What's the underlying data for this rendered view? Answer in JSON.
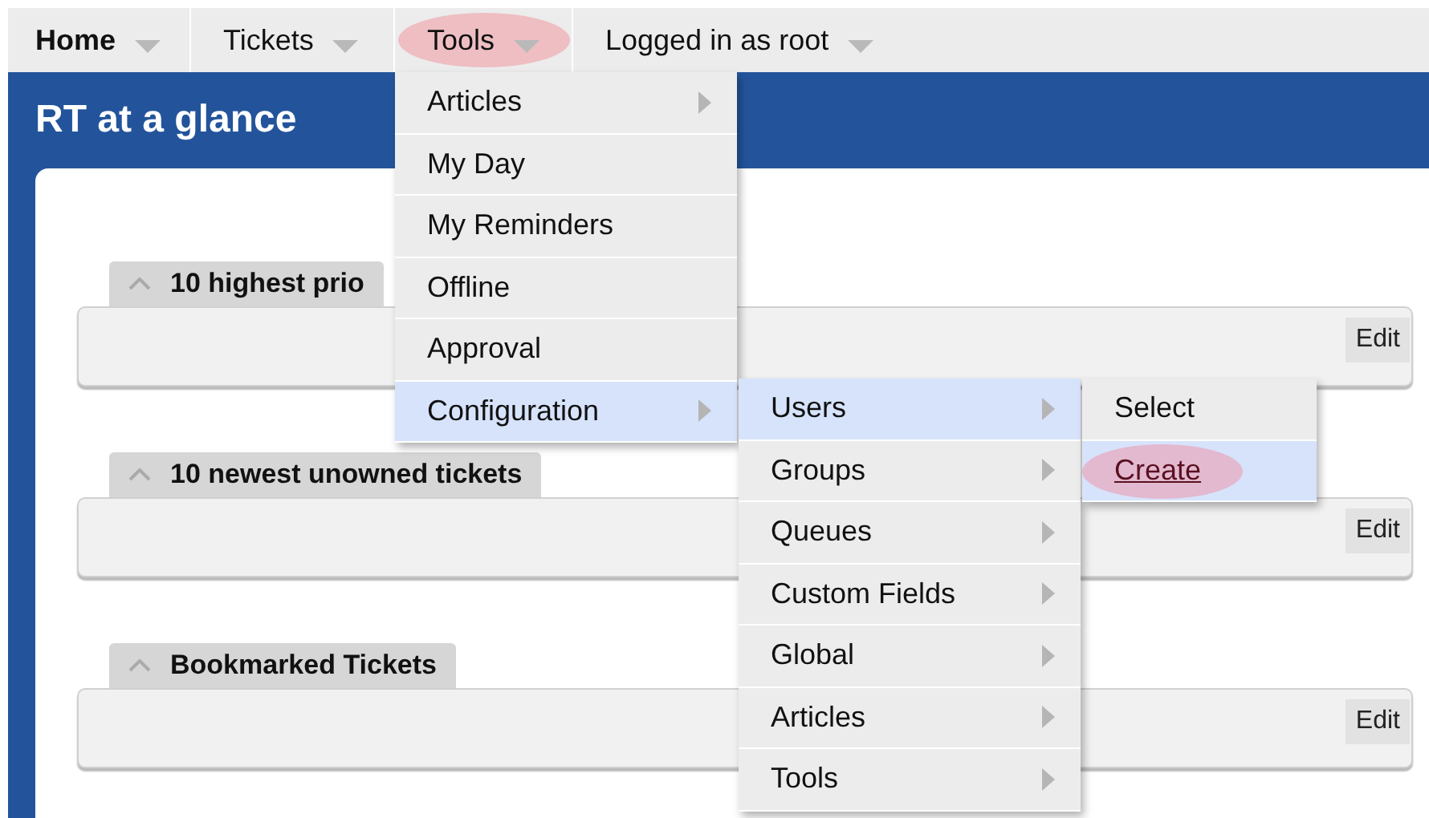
{
  "nav": [
    {
      "label": "Home",
      "bold": true,
      "circled": false
    },
    {
      "label": "Tickets",
      "bold": false,
      "circled": false
    },
    {
      "label": "Tools",
      "bold": false,
      "circled": true
    },
    {
      "label": "Logged in as root",
      "bold": false,
      "circled": false
    }
  ],
  "page_title": "RT at a glance",
  "portlets": [
    {
      "title": "10 highest prio",
      "edit": "Edit"
    },
    {
      "title": "10 newest unowned tickets",
      "edit": "Edit"
    },
    {
      "title": "Bookmarked Tickets",
      "edit": "Edit"
    }
  ],
  "tools_menu": [
    {
      "label": "Articles",
      "has_submenu": true,
      "highlighted": false,
      "circled": false
    },
    {
      "label": "My Day",
      "has_submenu": false,
      "highlighted": false,
      "circled": false
    },
    {
      "label": "My Reminders",
      "has_submenu": false,
      "highlighted": false,
      "circled": false
    },
    {
      "label": "Offline",
      "has_submenu": false,
      "highlighted": false,
      "circled": false
    },
    {
      "label": "Approval",
      "has_submenu": false,
      "highlighted": false,
      "circled": false
    },
    {
      "label": "Configuration",
      "has_submenu": true,
      "highlighted": true,
      "circled": false
    }
  ],
  "configuration_menu": [
    {
      "label": "Users",
      "has_submenu": true,
      "highlighted": true,
      "circled": false
    },
    {
      "label": "Groups",
      "has_submenu": true,
      "highlighted": false,
      "circled": false
    },
    {
      "label": "Queues",
      "has_submenu": true,
      "highlighted": false,
      "circled": false
    },
    {
      "label": "Custom Fields",
      "has_submenu": true,
      "highlighted": false,
      "circled": false
    },
    {
      "label": "Global",
      "has_submenu": true,
      "highlighted": false,
      "circled": false
    },
    {
      "label": "Articles",
      "has_submenu": true,
      "highlighted": false,
      "circled": false
    },
    {
      "label": "Tools",
      "has_submenu": true,
      "highlighted": false,
      "circled": false
    }
  ],
  "users_menu": [
    {
      "label": "Select",
      "has_submenu": false,
      "highlighted": false,
      "circled": false
    },
    {
      "label": "Create",
      "has_submenu": false,
      "highlighted": true,
      "circled": true
    }
  ]
}
